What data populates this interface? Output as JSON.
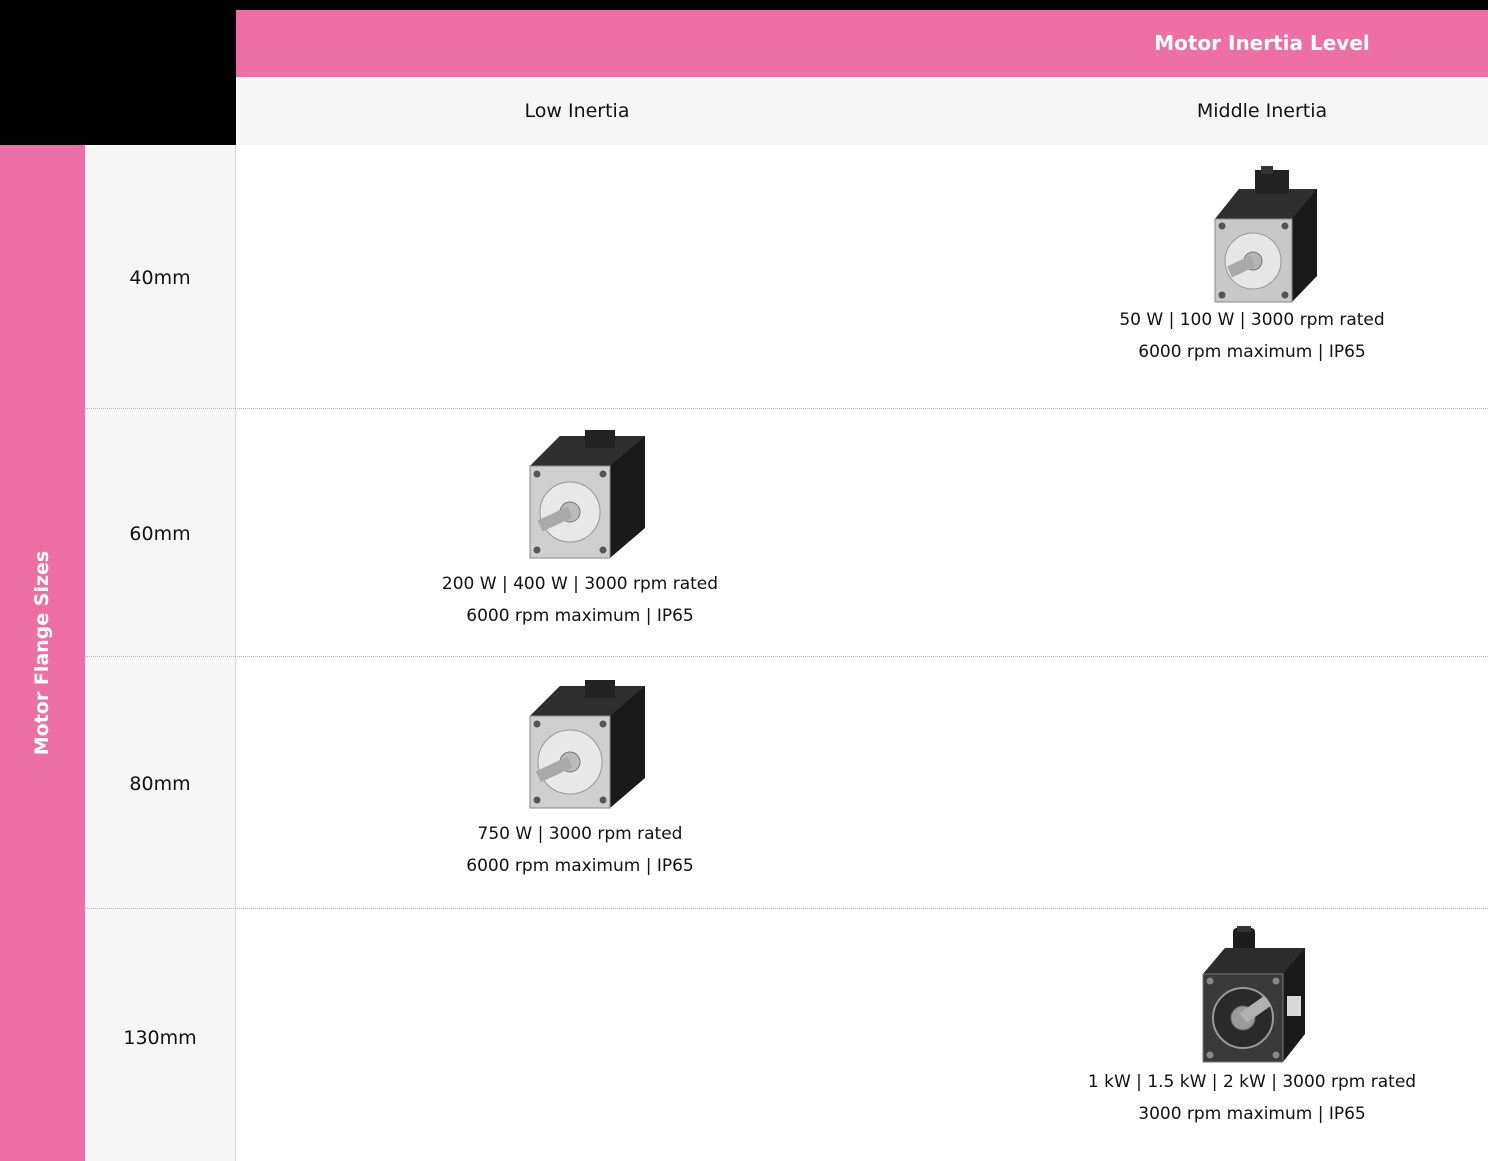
{
  "header": {
    "group_title": "Motor Inertia Level",
    "columns": [
      {
        "label": "Low Inertia"
      },
      {
        "label": "Middle Inertia"
      }
    ]
  },
  "side": {
    "title": "Motor Flange Sizes",
    "rows": [
      {
        "label": "40mm"
      },
      {
        "label": "60mm"
      },
      {
        "label": "80mm"
      },
      {
        "label": "130mm"
      }
    ]
  },
  "cells": {
    "r40_middle": {
      "line1": "50 W  | 100 W  |  3000 rpm rated",
      "line2": "6000 rpm maximum  |  IP65"
    },
    "r60_low": {
      "line1": "200 W  |  400 W  |  3000 rpm rated",
      "line2": "6000 rpm maximum  |  IP65"
    },
    "r80_low": {
      "line1": "750 W  |  3000 rpm rated",
      "line2": "6000 rpm maximum  |  IP65"
    },
    "r130_middle": {
      "line1": "1 kW  |  1.5 kW  |  2 kW  |  3000 rpm rated",
      "line2": "3000 rpm maximum  |  IP65"
    }
  },
  "colors": {
    "accent": "#ee6fa6",
    "header_dark": "#000000",
    "panel_gray": "#f6f6f6"
  }
}
